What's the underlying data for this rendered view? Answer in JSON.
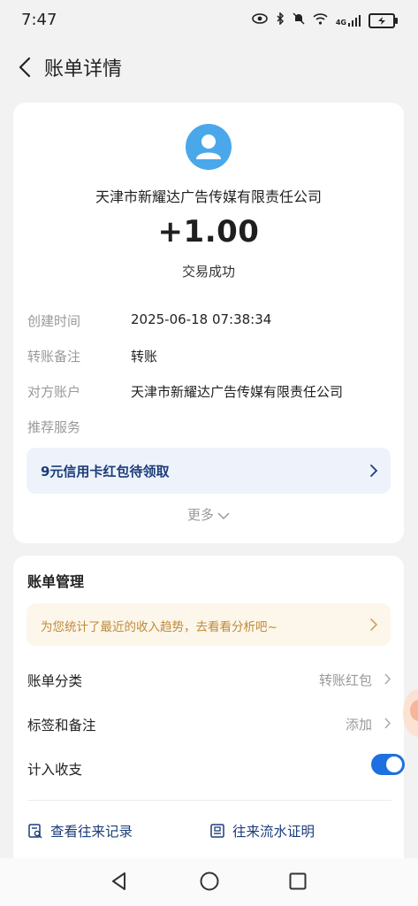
{
  "status_bar": {
    "time": "7:47",
    "network": "4G"
  },
  "header": {
    "title": "账单详情"
  },
  "transaction": {
    "counterparty": "天津市新耀达广告传媒有限责任公司",
    "amount": "+1.00",
    "status": "交易成功",
    "avatar_color": "#4aa8ea"
  },
  "details": [
    {
      "label": "创建时间",
      "value": "2025-06-18 07:38:34"
    },
    {
      "label": "转账备注",
      "value": "转账"
    },
    {
      "label": "对方账户",
      "value": "天津市新耀达广告传媒有限责任公司"
    },
    {
      "label": "推荐服务",
      "value": ""
    }
  ],
  "promo": {
    "text": "9元信用卡红包待领取"
  },
  "more_label": "更多",
  "management": {
    "title": "账单管理",
    "tip": "为您统计了最近的收入趋势，去看看分析吧~",
    "category_label": "账单分类",
    "category_value": "转账红包",
    "tags_label": "标签和备注",
    "tags_value": "添加",
    "income_label": "计入收支",
    "income_enabled": true
  },
  "links": {
    "records": "查看往来记录",
    "proof": "往来流水证明"
  },
  "colors": {
    "accent": "#1e6fe0",
    "link": "#1c3d7a",
    "tip_text": "#bf8a3a"
  }
}
